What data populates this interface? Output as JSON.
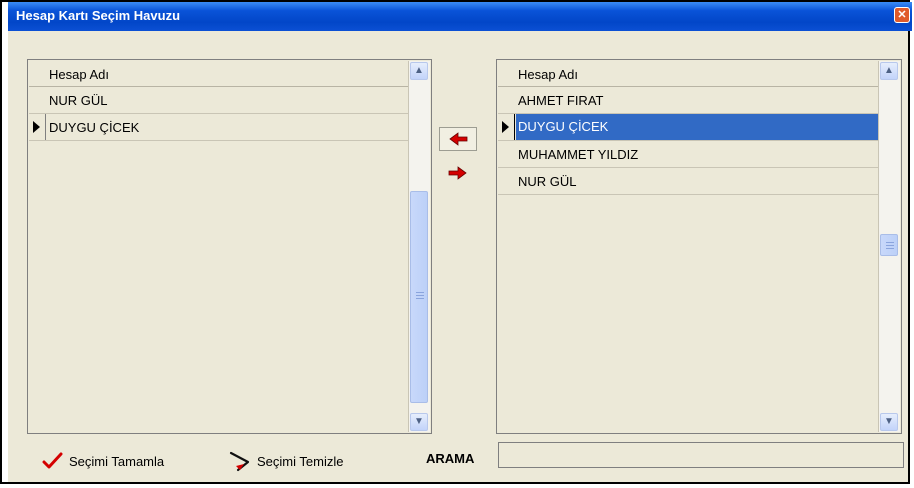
{
  "window": {
    "title": "Hesap Kartı Seçim Havuzu",
    "close_glyph": "✕"
  },
  "left_grid": {
    "header": "Hesap Adı",
    "rows": [
      "NUR GÜL",
      "DUYGU ÇİCEK"
    ],
    "current_row_index": 1
  },
  "right_grid": {
    "header": "Hesap Adı",
    "rows": [
      "AHMET FIRAT",
      "DUYGU ÇİCEK",
      "MUHAMMET YILDIZ",
      "NUR GÜL"
    ],
    "selected_row_index": 1
  },
  "transfer": {
    "move_left_icon": "red-left-arrow-icon",
    "move_right_icon": "red-right-arrow-icon"
  },
  "footer": {
    "complete_label": "Seçimi Tamamla",
    "clear_label": "Seçimi Temizle",
    "search_label": "ARAMA",
    "search_value": ""
  },
  "colors": {
    "selection": "#316ac5",
    "titlebar": "#0a53d8",
    "arrow": "#d40000",
    "check": "#d40000"
  }
}
